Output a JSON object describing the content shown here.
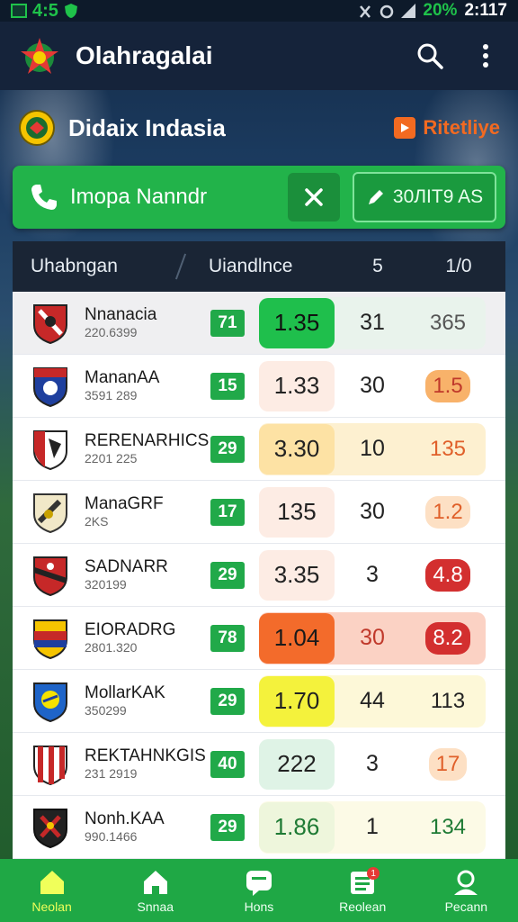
{
  "status_bar": {
    "left_text": "4:5",
    "battery": "20%",
    "time": "2:117"
  },
  "app_bar": {
    "title": "Olahragalai"
  },
  "league": {
    "name": "Didaix Indasia",
    "live_label": "Ritetliye"
  },
  "filter": {
    "label": "Imopa Nanndr",
    "action_label": "30ЛIT9 AS"
  },
  "table": {
    "headers": {
      "team": "Uhabngan",
      "value": "Uiandlnce",
      "col3": "5",
      "col4": "1/0"
    },
    "rows": [
      {
        "name": "Nnanacia",
        "sub": "220.6399",
        "rank": "71",
        "odds": "1.35",
        "c3": "31",
        "c4": "365"
      },
      {
        "name": "MananAA",
        "sub": "3591 289",
        "rank": "15",
        "odds": "1.33",
        "c3": "30",
        "c4": "1.5"
      },
      {
        "name": "RERENARHICS",
        "sub": "2201 225",
        "rank": "29",
        "odds": "3.30",
        "c3": "10",
        "c4": "135"
      },
      {
        "name": "ManaGRF",
        "sub": "2KS",
        "rank": "17",
        "odds": "135",
        "c3": "30",
        "c4": "1.2"
      },
      {
        "name": "SADNARR",
        "sub": "320199",
        "rank": "29",
        "odds": "3.35",
        "c3": "3",
        "c4": "4.8"
      },
      {
        "name": "EIORADRG",
        "sub": "2801.320",
        "rank": "78",
        "odds": "1.04",
        "c3": "30",
        "c4": "8.2"
      },
      {
        "name": "MollarKAK",
        "sub": "350299",
        "rank": "29",
        "odds": "1.70",
        "c3": "44",
        "c4": "113"
      },
      {
        "name": "REKTAHNKGIS",
        "sub": "231 2919",
        "rank": "40",
        "odds": "222",
        "c3": "3",
        "c4": "17"
      },
      {
        "name": "Nonh.KAA",
        "sub": "990.1466",
        "rank": "29",
        "odds": "1.86",
        "c3": "1",
        "c4": "134"
      }
    ]
  },
  "bottom_nav": {
    "items": [
      {
        "label": "Neolan"
      },
      {
        "label": "Snnaa"
      },
      {
        "label": "Hons"
      },
      {
        "label": "Reolean"
      },
      {
        "label": "Pecann"
      }
    ],
    "badge": "1"
  },
  "colors": {
    "brand_green": "#22b34a",
    "header_dark": "#15233a",
    "accent_orange": "#f26a21"
  }
}
